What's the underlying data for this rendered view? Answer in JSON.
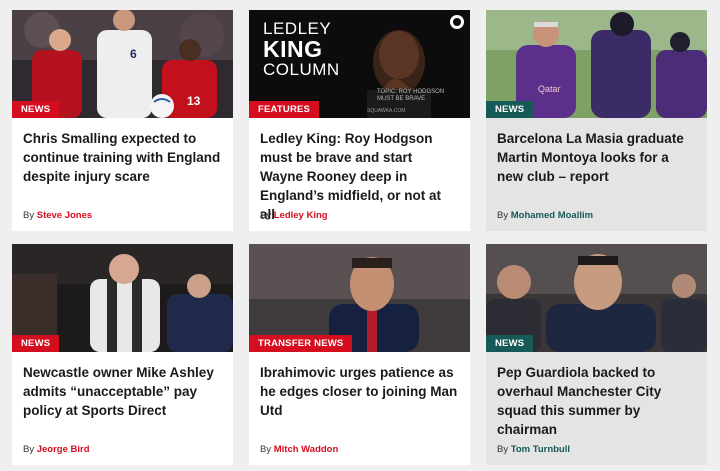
{
  "colors": {
    "news_red": "#d50e1f",
    "teal": "#155a56",
    "page_bg": "#efefef"
  },
  "articles": [
    {
      "tag": "NEWS",
      "headline": "Chris Smalling expected to continue training with England despite injury scare",
      "by": "By",
      "author": "Steve Jones"
    },
    {
      "tag": "FEATURES",
      "headline": "Ledley King: Roy Hodgson must be brave and start Wayne Rooney deep in England’s midfield, or not at all",
      "by": "By",
      "author": "Ledley King",
      "image_text": {
        "line1": "LEDLEY",
        "line2": "KING",
        "line3": "COLUMN",
        "topic1": "TOPIC: ROY HODGSON",
        "topic2": "MUST BE BRAVE",
        "site": "SQUAWKA.COM"
      }
    },
    {
      "tag": "NEWS",
      "headline": "Barcelona La Masia graduate Martin Montoya looks for a new club – report",
      "by": "By",
      "author": "Mohamed Moallim",
      "image_text": {
        "shirt": "Qatar"
      }
    },
    {
      "tag": "NEWS",
      "headline": "Newcastle owner Mike Ashley admits “unacceptable” pay policy at Sports Direct",
      "by": "By",
      "author": "Jeorge Bird"
    },
    {
      "tag": "TRANSFER NEWS",
      "headline": "Ibrahimovic urges patience as he edges closer to joining Man Utd",
      "by": "By",
      "author": "Mitch Waddon"
    },
    {
      "tag": "NEWS",
      "headline": "Pep Guardiola backed to overhaul Manchester City squad this summer by chairman",
      "by": "By",
      "author": "Tom Turnbull"
    }
  ]
}
